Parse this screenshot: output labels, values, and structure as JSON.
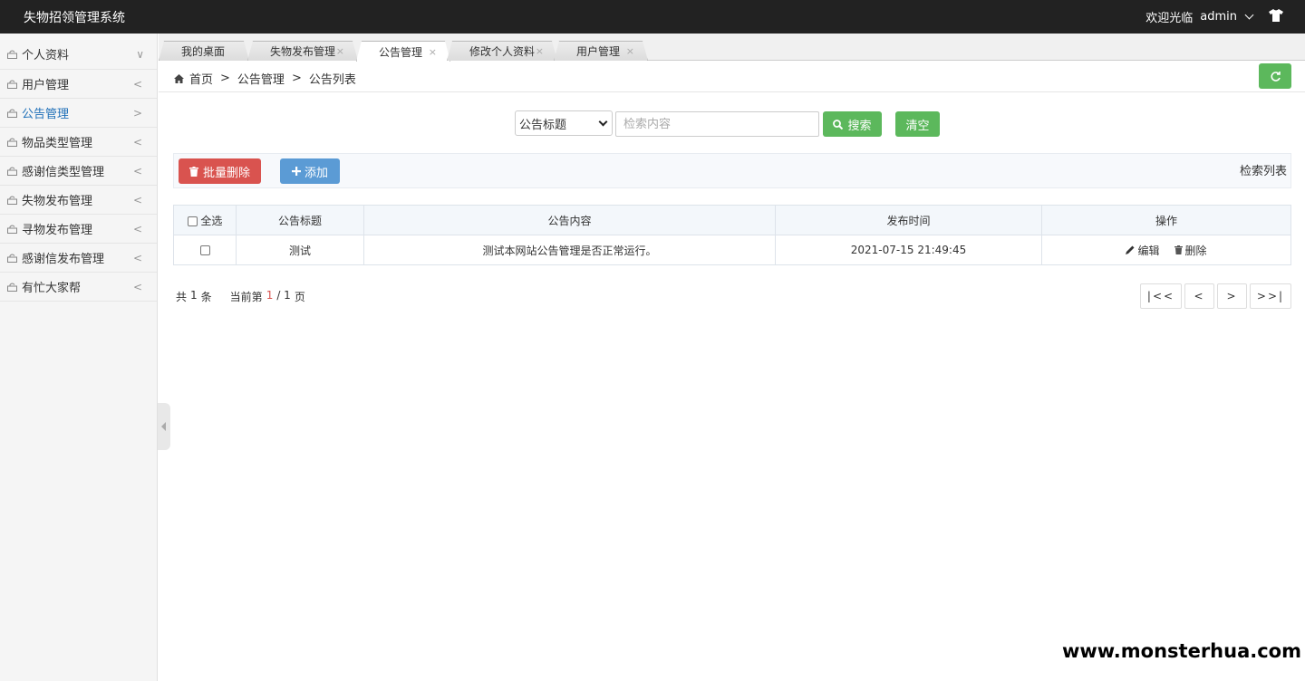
{
  "app": {
    "title": "失物招领管理系统"
  },
  "user": {
    "greeting": "欢迎光临",
    "name": "admin"
  },
  "sidebar": {
    "items": [
      {
        "label": "个人资料",
        "arrow": "∨"
      },
      {
        "label": "用户管理",
        "arrow": "<"
      },
      {
        "label": "公告管理",
        "arrow": ">"
      },
      {
        "label": "物品类型管理",
        "arrow": "<"
      },
      {
        "label": "感谢信类型管理",
        "arrow": "<"
      },
      {
        "label": "失物发布管理",
        "arrow": "<"
      },
      {
        "label": "寻物发布管理",
        "arrow": "<"
      },
      {
        "label": "感谢信发布管理",
        "arrow": "<"
      },
      {
        "label": "有忙大家帮",
        "arrow": "<"
      }
    ]
  },
  "tabs": [
    {
      "label": "我的桌面"
    },
    {
      "label": "失物发布管理",
      "close": "×"
    },
    {
      "label": "公告管理",
      "close": "×"
    },
    {
      "label": "修改个人资料",
      "close": "×"
    },
    {
      "label": "用户管理",
      "close": "×"
    }
  ],
  "breadcrumb": {
    "home": "首页",
    "sep": ">",
    "section": "公告管理",
    "page": "公告列表"
  },
  "search": {
    "field_selected": "公告标题",
    "placeholder": "检索内容",
    "search_label": "搜索",
    "clear_label": "清空"
  },
  "toolbar": {
    "batch_delete": "批量删除",
    "add": "添加",
    "title": "检索列表"
  },
  "table": {
    "headers": {
      "select_all": "全选",
      "title": "公告标题",
      "content": "公告内容",
      "time": "发布时间",
      "ops": "操作"
    },
    "rows": [
      {
        "title": "测试",
        "content": "测试本网站公告管理是否正常运行。",
        "time": "2021-07-15 21:49:45",
        "edit": "编辑",
        "delete": "删除"
      }
    ]
  },
  "pager": {
    "total_prefix": "共",
    "total": "1",
    "total_suffix": "条",
    "current_prefix": "当前第",
    "current": "1",
    "pages": "/ 1",
    "pages_suffix": "页",
    "first": "|<<",
    "prev": "<",
    "next": ">",
    "last": ">>|"
  },
  "watermark": "www.monsterhua.com",
  "colors": {
    "topbar": "#222222",
    "green": "#5cb85c",
    "red": "#d9534f",
    "blue": "#5b9bd5",
    "active_link": "#1e6fb8"
  }
}
